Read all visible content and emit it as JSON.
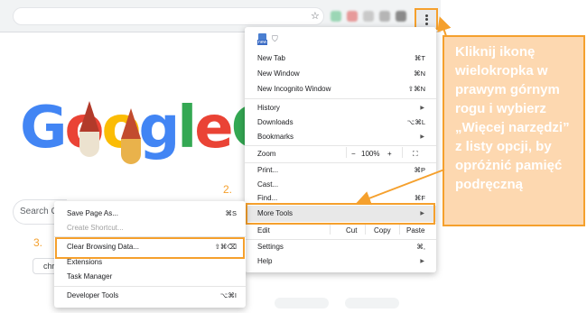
{
  "browser": {
    "star_icon": "star-icon",
    "menu_icon": "vertical-ellipsis-icon"
  },
  "page": {
    "logo_letters": [
      "G",
      "o",
      "o",
      "g",
      "l",
      "e",
      "G"
    ],
    "logo_colors": [
      "#4285f4",
      "#ea4335",
      "#fbbc05",
      "#4285f4",
      "#34a853",
      "#ea4335",
      "#34a853"
    ],
    "search_placeholder": "Search G",
    "chip_label": "chr"
  },
  "menu": {
    "items": {
      "new_tab": {
        "label": "New Tab",
        "shortcut": "⌘T"
      },
      "new_window": {
        "label": "New Window",
        "shortcut": "⌘N"
      },
      "new_incognito": {
        "label": "New Incognito Window",
        "shortcut": "⇧⌘N"
      },
      "history": {
        "label": "History"
      },
      "downloads": {
        "label": "Downloads",
        "shortcut": "⌥⌘L"
      },
      "bookmarks": {
        "label": "Bookmarks"
      },
      "zoom": {
        "label": "Zoom",
        "minus": "−",
        "value": "100%",
        "plus": "+",
        "fullscreen": "⛶"
      },
      "print": {
        "label": "Print...",
        "shortcut": "⌘P"
      },
      "cast": {
        "label": "Cast..."
      },
      "find": {
        "label": "Find...",
        "shortcut": "⌘F"
      },
      "more_tools": {
        "label": "More Tools"
      },
      "edit": {
        "label": "Edit",
        "cut": "Cut",
        "copy": "Copy",
        "paste": "Paste"
      },
      "settings": {
        "label": "Settings",
        "shortcut": "⌘,"
      },
      "help": {
        "label": "Help"
      }
    }
  },
  "submenu": {
    "save_page": {
      "label": "Save Page As...",
      "shortcut": "⌘S"
    },
    "create_shortcut": {
      "label": "Create Shortcut..."
    },
    "clear_data": {
      "label": "Clear Browsing Data...",
      "shortcut": "⇧⌘⌫"
    },
    "extensions": {
      "label": "Extensions"
    },
    "task_manager": {
      "label": "Task Manager"
    },
    "developer_tools": {
      "label": "Developer Tools",
      "shortcut": "⌥⌘I"
    }
  },
  "annotations": {
    "step2": "2.",
    "step3": "3.",
    "callout_text": "Kliknij ikonę wielokropka w prawym górnym rogu i wybierz „Więcej narzędzi” z listy opcji, by opróżnić pamięć podręczną",
    "accent_color": "#f5a02d",
    "callout_bg": "#fdd8b0"
  }
}
